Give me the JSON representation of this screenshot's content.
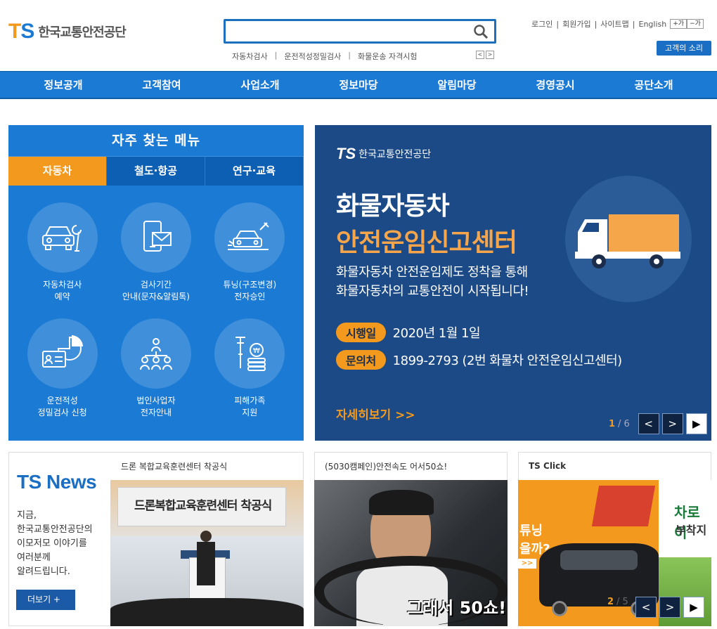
{
  "header": {
    "logo_mark_t": "T",
    "logo_mark_s": "S",
    "logo_name": "한국교통안전공단",
    "search": {
      "placeholder": ""
    },
    "quick_links": [
      "자동차검사",
      "운전적성정밀검사",
      "화물운송 자격시험"
    ],
    "quick_prev": "<",
    "quick_next": ">",
    "util_links": [
      "로그인",
      "회원가입",
      "사이트맵",
      "English"
    ],
    "font_up": "+가",
    "font_down": "−가",
    "voice_button": "고객의 소리"
  },
  "nav": {
    "items": [
      "정보공개",
      "고객참여",
      "사업소개",
      "정보마당",
      "알림마당",
      "경영공시",
      "공단소개"
    ]
  },
  "fav_menu": {
    "title": "자주 찾는 메뉴",
    "tabs": [
      {
        "label": "자동차",
        "active": true
      },
      {
        "label": "철도·항공",
        "active": false
      },
      {
        "label": "연구·교육",
        "active": false
      }
    ],
    "items": [
      {
        "label": "자동차검사\n예약",
        "icon": "car-wrench-icon"
      },
      {
        "label": "검사기간\n안내(문자&알림톡)",
        "icon": "mobile-mail-icon"
      },
      {
        "label": "튜닝(구조변경)\n전자승인",
        "icon": "car-tuning-icon"
      },
      {
        "label": "운전적성\n정밀검사 신청",
        "icon": "license-chart-icon"
      },
      {
        "label": "법인사업자\n전자안내",
        "icon": "people-org-icon"
      },
      {
        "label": "피해가족\n지원",
        "icon": "crutch-coins-icon"
      }
    ]
  },
  "banner": {
    "logo_mark": "TS",
    "logo_name": "한국교통안전공단",
    "title_1": "화물자동차",
    "title_2": "안전운임신고센터",
    "description": "화물자동차 안전운임제도 정착을 통해\n화물자동차의 교통안전이 시작됩니다!",
    "date_label": "시행일",
    "date_value": "2020년 1월 1일",
    "contact_label": "문의처",
    "contact_value": "1899-2793 (2번 화물차 안전운임신고센터)",
    "more": "자세히보기 >>",
    "page_current": "1",
    "page_sep": "/",
    "page_total": "6",
    "prev": "<",
    "next": ">",
    "play": "▶"
  },
  "news": {
    "title": "TS News",
    "description": "지금,\n한국교통안전공단의\n이모저모 이야기를\n여러분께\n알려드립니다.",
    "more": "더보기 +",
    "card_title": "드론 복합교육훈련센터 착공식",
    "image_caption": "드론복합교육훈련센터 착공식"
  },
  "campaign": {
    "card_title": "(5030캠페인)안전속도 어서50쇼!",
    "image_caption": "그래서 50쇼!"
  },
  "click": {
    "card_title": "TS Click",
    "text_1": "튜닝",
    "text_2": "을까?",
    "text_3": "차로이",
    "text_4": "부착지",
    "pager_current": "2",
    "pager_sep": "/",
    "pager_total": "5",
    "prev": "<",
    "next": ">",
    "play": "▶"
  },
  "colors": {
    "primary": "#1a7ad4",
    "orange": "#f39a1e",
    "banner_bg": "#1b4a86"
  }
}
